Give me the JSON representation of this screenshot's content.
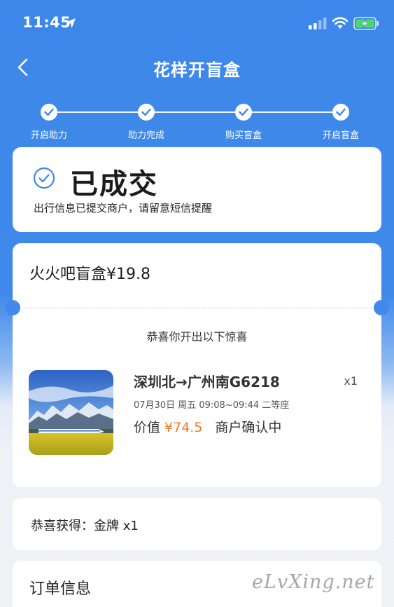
{
  "status_bar": {
    "time": "11:45"
  },
  "nav": {
    "title": "花样开盲盒"
  },
  "steps": [
    {
      "label": "开启助力",
      "done": true
    },
    {
      "label": "助力完成",
      "done": true
    },
    {
      "label": "购买盲盒",
      "done": true
    },
    {
      "label": "开启盲盒",
      "done": true
    }
  ],
  "status_card": {
    "title": "已成交",
    "description": "出行信息已提交商户，请留意短信提醒"
  },
  "box_card": {
    "title": "火火吧盲盒¥19.8",
    "congrats": "恭喜你开出以下惊喜",
    "item": {
      "route": "深圳北→广州南G6218",
      "qty": "x1",
      "trip_info": "07月30日 周五 09:08~09:44 二等座",
      "value_label": "价值",
      "price": "¥74.5",
      "merchant_status": "商户确认中"
    }
  },
  "prize_card": {
    "text": "恭喜获得：金牌 x1"
  },
  "order_card": {
    "title": "订单信息"
  },
  "watermark": "eLvXing.net",
  "colors": {
    "primary_blue": "#3d87ea",
    "price_orange": "#f07c2a"
  },
  "icons": [
    "location-arrow-icon",
    "signal-icon",
    "wifi-icon",
    "battery-charging-icon",
    "back-chevron-icon",
    "checkmark-icon",
    "success-check-circle-icon"
  ]
}
